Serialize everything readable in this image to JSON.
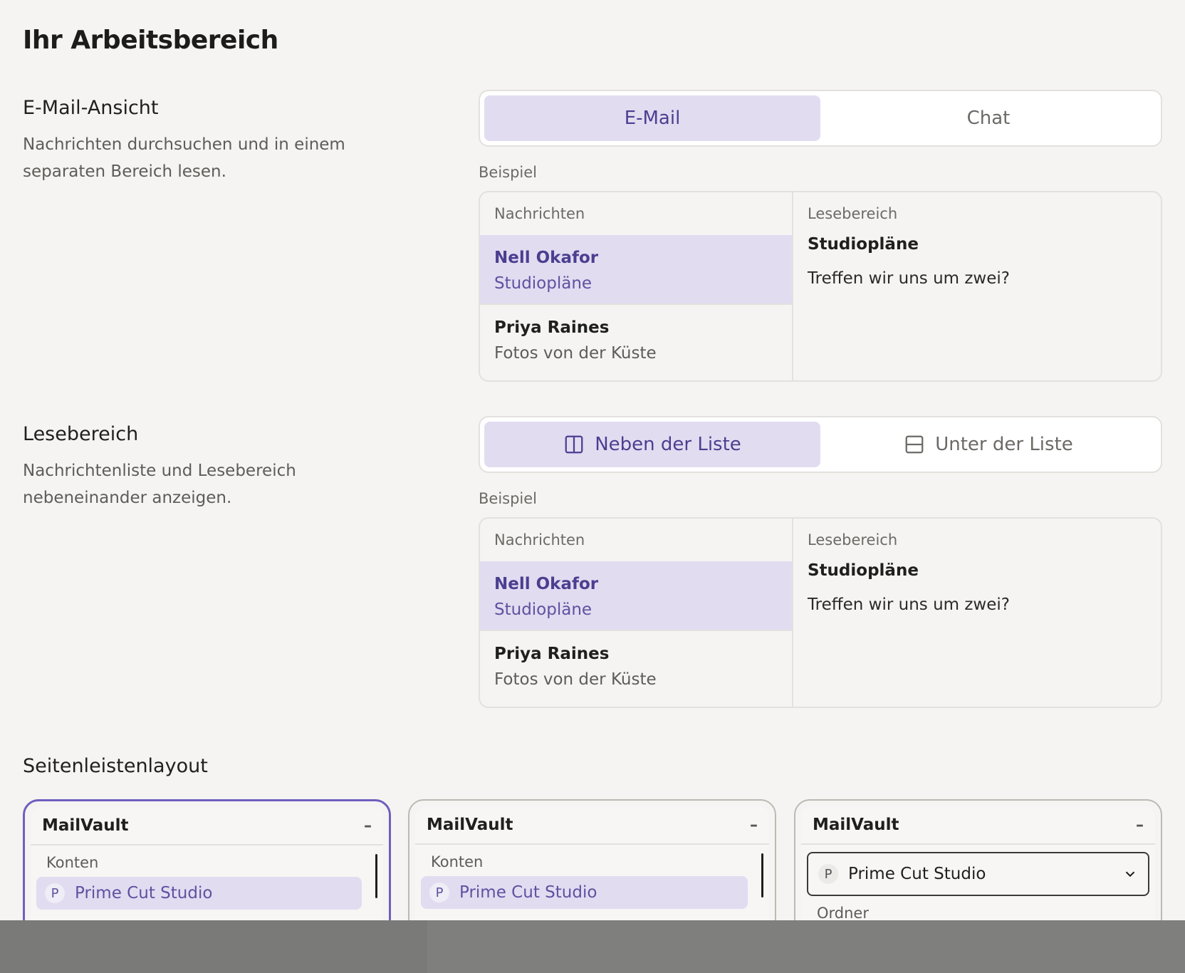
{
  "page": {
    "title": "Ihr Arbeitsbereich"
  },
  "mail_view": {
    "label": "E-Mail-Ansicht",
    "description": "Nachrichten durchsuchen und in einem separaten Bereich lesen.",
    "options": [
      "E-Mail",
      "Chat"
    ],
    "selected": "E-Mail",
    "example_label": "Beispiel"
  },
  "reading_pane": {
    "label": "Lesebereich",
    "description": "Nachrichtenliste und Lesebereich nebeneinander anzeigen.",
    "options": [
      "Neben der Liste",
      "Unter der Liste"
    ],
    "option_icons": [
      "columns-icon",
      "rows-icon"
    ],
    "selected": "Neben der Liste",
    "example_label": "Beispiel"
  },
  "preview": {
    "list_header": "Nachrichten",
    "reading_header": "Lesebereich",
    "messages": [
      {
        "sender": "Nell Okafor",
        "subject": "Studiopläne",
        "selected": true
      },
      {
        "sender": "Priya Raines",
        "subject": "Fotos von der Küste",
        "selected": false
      }
    ],
    "reading_title": "Studiopläne",
    "reading_body": "Treffen wir uns um zwei?"
  },
  "sidebar_layout": {
    "label": "Seitenleistenlayout",
    "cards": [
      {
        "app": "MailVault",
        "minimize": "–",
        "section": "Konten",
        "account_initial": "P",
        "account": "Prime Cut Studio",
        "selected": true
      },
      {
        "app": "MailVault",
        "minimize": "–",
        "section": "Konten",
        "account_initial": "P",
        "account": "Prime Cut Studio",
        "selected": false
      },
      {
        "app": "MailVault",
        "minimize": "–",
        "account_initial": "P",
        "account": "Prime Cut Studio",
        "section": "Ordner",
        "selected": false
      }
    ]
  },
  "colors": {
    "accent": "#4b3f90",
    "accent_bg": "#e2dcf1",
    "selected_border": "#6f5fbf",
    "page_bg": "#f5f4f2"
  }
}
